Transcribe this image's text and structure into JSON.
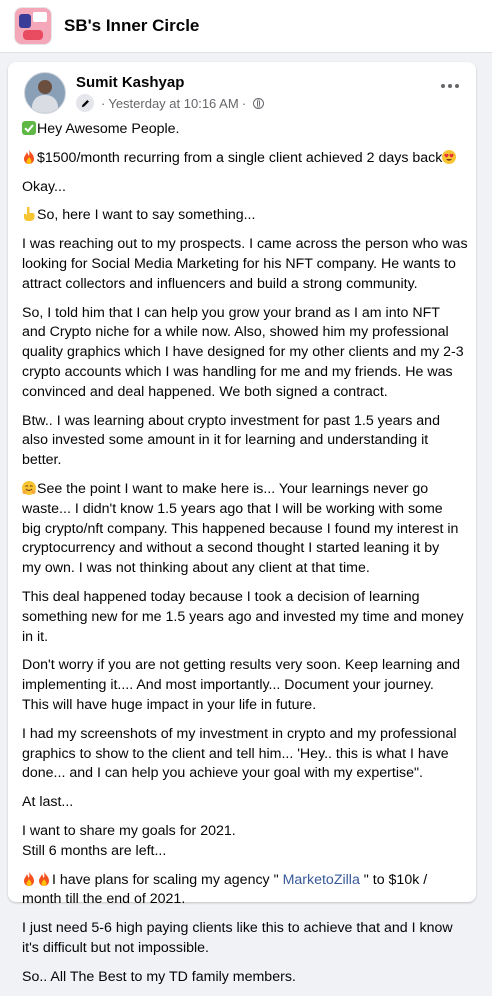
{
  "group": {
    "name": "SB's Inner Circle"
  },
  "post": {
    "author": "Sumit Kashyap",
    "timestamp": "Yesterday at 10:16 AM",
    "link_text": "MarketoZilla",
    "lines": {
      "l01": "Hey Awesome People.",
      "l02": "$1500/month recurring from a single client achieved 2 days back",
      "l03": "Okay...",
      "l04": "So, here I want to say something...",
      "l05": "I was reaching out to my prospects. I came across the person who was",
      "l06": "looking for Social Media Marketing for his NFT company. He wants to",
      "l07": "attract collectors and influencers and build a strong community.",
      "l08": "So, I told him that I can help you grow your brand as I am into NFT",
      "l09": "and Crypto niche for a while now. Also, showed him my professional",
      "l10": "quality graphics which I have designed for my other clients and my 2-3",
      "l11": "crypto accounts which I was handling for me and my friends. He was",
      "l12": "convinced and deal happened. We both signed a contract.",
      "l13": "Btw.. I was learning about crypto investment for past 1.5 years and",
      "l14": "also invested some  amount in it for learning and understanding it",
      "l15": "better.",
      "l16": "See the point I want to make here is...  Your learnings never go",
      "l17": "waste... I didn't know 1.5 years ago that I will be working with some",
      "l18": "big crypto/nft company. This happened because I found my interest in",
      "l19": "cryptocurrency and without a second thought I started leaning it by",
      "l20": "my own. I was not thinking about any client at that time.",
      "l21": "This deal happened today because I took a decision of learning",
      "l22": "something new for me 1.5 years ago and invested my time and money",
      "l23": "in it.",
      "l24": "Don't worry if you are not getting results very soon. Keep learning and",
      "l25": "implementing it.... And most importantly... Document your journey.",
      "l26": "This will have huge impact in your life in future.",
      "l27": "I had my screenshots of my investment in crypto and my professional",
      "l28": "graphics to show  to the client and tell him... 'Hey.. this is what I have",
      "l29": "done... and I can help you achieve your goal with my expertise\".",
      "l30": "At last...",
      "l31": "I want to share my goals for 2021.",
      "l32": "Still 6 months are left...",
      "l33a": "I have plans for scaling my agency \" ",
      "l33b": " \" to $10k /",
      "l34": "month till the end of 2021.",
      "l35": "I just need 5-6 high paying clients like this to achieve that and I know",
      "l36": "it's difficult but not impossible.",
      "l37": "So.. All The Best to my TD family members."
    }
  }
}
